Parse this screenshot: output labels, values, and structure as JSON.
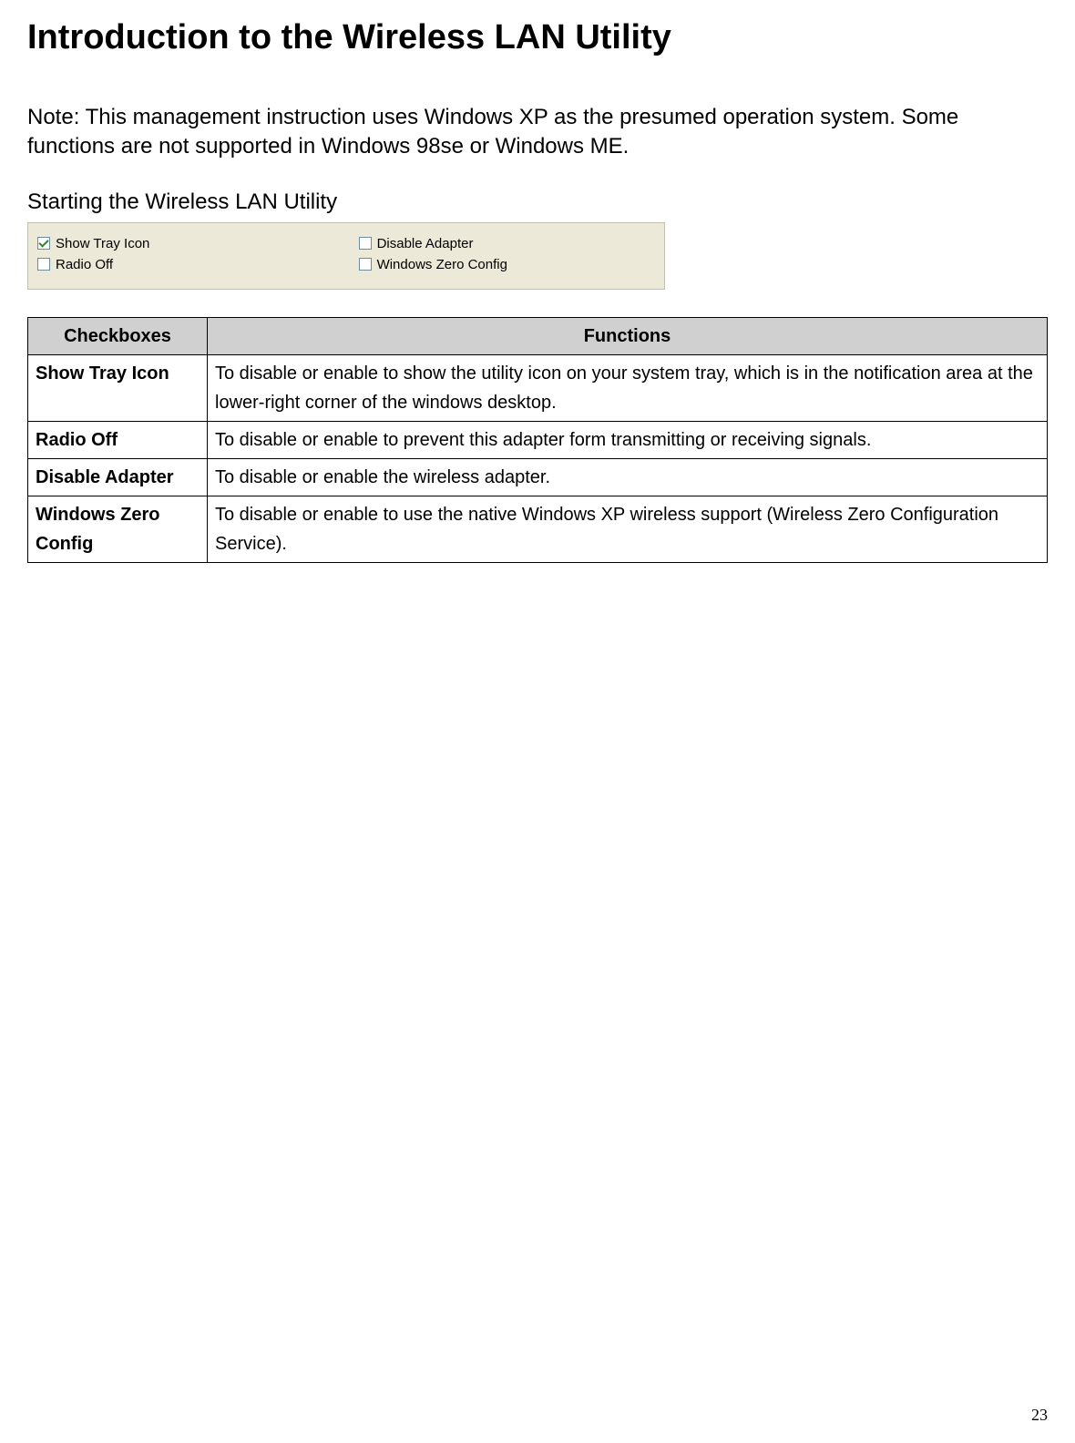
{
  "title": "Introduction to the Wireless LAN Utility",
  "note": "Note: This management instruction uses Windows XP as the presumed operation system. Some functions are not supported in Windows 98se or Windows ME.",
  "subheading": "Starting the Wireless LAN Utility",
  "panel": {
    "show_tray_icon": {
      "label": "Show Tray Icon",
      "checked": true
    },
    "disable_adapter": {
      "label": "Disable Adapter",
      "checked": false
    },
    "radio_off": {
      "label": "Radio Off",
      "checked": false
    },
    "windows_zero_config": {
      "label": "Windows Zero Config",
      "checked": false
    }
  },
  "table": {
    "header_col1": "Checkboxes",
    "header_col2": "Functions",
    "rows": [
      {
        "name": "Show Tray Icon",
        "desc": "To disable or enable to show the utility icon on your system tray, which is in the notification area at the lower-right corner of the windows desktop."
      },
      {
        "name": "Radio Off",
        "desc": "To disable or enable to prevent this adapter form transmitting or receiving signals."
      },
      {
        "name": "Disable Adapter",
        "desc": "To disable or enable the wireless adapter."
      },
      {
        "name": "Windows Zero Config",
        "desc": "To disable or enable to use the native Windows XP wireless support (Wireless Zero Configuration Service)."
      }
    ]
  },
  "page_number": "23"
}
